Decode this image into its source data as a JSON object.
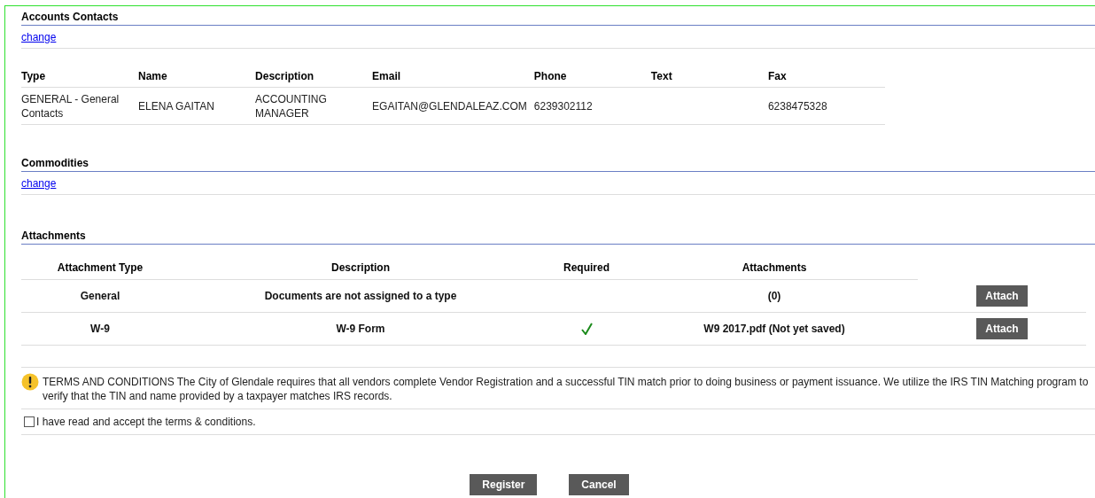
{
  "accounts_contacts": {
    "title": "Accounts Contacts",
    "change_link": "change",
    "columns": [
      "Type",
      "Name",
      "Description",
      "Email",
      "Phone",
      "Text",
      "Fax"
    ],
    "rows": [
      [
        "GENERAL - General Contacts",
        "ELENA GAITAN",
        "ACCOUNTING MANAGER",
        "EGAITAN@GLENDALEAZ.COM",
        "6239302112",
        "",
        "6238475328"
      ]
    ]
  },
  "commodities": {
    "title": "Commodities",
    "change_link": "change"
  },
  "attachments": {
    "title": "Attachments",
    "columns": [
      "Attachment Type",
      "Description",
      "Required",
      "Attachments"
    ],
    "rows": [
      {
        "type": "General",
        "description": "Documents are not assigned to a type",
        "required": false,
        "attachments": "(0)",
        "button": "Attach"
      },
      {
        "type": "W-9",
        "description": "W-9 Form",
        "required": true,
        "attachments": "W9 2017.pdf (Not yet saved)",
        "button": "Attach"
      }
    ]
  },
  "terms": {
    "text": "TERMS AND CONDITIONS The City of Glendale requires that all vendors complete Vendor Registration and a successful TIN match prior to doing business or payment issuance. We utilize the IRS TIN Matching program to verify that the TIN and name provided by a taxpayer matches IRS records.",
    "accept_label": "I have read and accept the terms & conditions.",
    "accepted": false
  },
  "buttons": [
    "Register",
    "Cancel"
  ]
}
